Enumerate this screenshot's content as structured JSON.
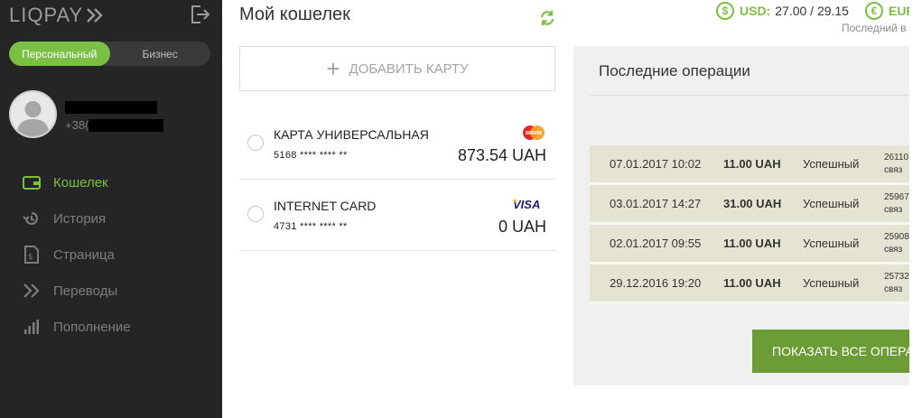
{
  "brand": {
    "name": "LIQPAY"
  },
  "sidebar": {
    "account_types": [
      "Персональный",
      "Бизнес"
    ],
    "active_account_type": "Персональный",
    "profile": {
      "phone_prefix": "+38("
    },
    "nav": [
      {
        "label": "Кошелек",
        "icon": "wallet-icon",
        "active": true
      },
      {
        "label": "История",
        "icon": "history-icon",
        "active": false
      },
      {
        "label": "Страница",
        "icon": "page-icon",
        "active": false
      },
      {
        "label": "Переводы",
        "icon": "transfers-icon",
        "active": false
      },
      {
        "label": "Пополнение",
        "icon": "topup-icon",
        "active": false
      }
    ]
  },
  "wallet": {
    "title": "Мой кошелек",
    "add_card_label": "ДОБАВИТЬ КАРТУ",
    "cards": [
      {
        "name": "КАРТА УНИВЕРСАЛЬНАЯ",
        "number": "5168 **** **** **",
        "balance": "873.54 UAH",
        "brand": "mastercard"
      },
      {
        "name": "INTERNET CARD",
        "number": "4731 **** **** **",
        "balance": "0 UAH",
        "brand": "visa"
      }
    ]
  },
  "rates": {
    "usd_symbol": "$",
    "usd_code": "USD:",
    "usd_value": "27.00 / 29.15",
    "eur_symbol": "€",
    "eur_code": "EUR",
    "note": "Последний в"
  },
  "operations": {
    "title": "Последние операции",
    "rows": [
      {
        "date": "07.01.2017 10:02",
        "amount": "11.00 UAH",
        "status": "Успешный",
        "id": "26110",
        "id_note": "связ"
      },
      {
        "date": "03.01.2017 14:27",
        "amount": "31.00 UAH",
        "status": "Успешный",
        "id": "25967",
        "id_note": "связ"
      },
      {
        "date": "02.01.2017 09:55",
        "amount": "11.00 UAH",
        "status": "Успешный",
        "id": "25908",
        "id_note": "связ"
      },
      {
        "date": "29.12.2016 19:20",
        "amount": "11.00 UAH",
        "status": "Успешный",
        "id": "25732",
        "id_note": "связ"
      }
    ],
    "show_all_label": "ПОКАЗАТЬ ВСЕ ОПЕРА"
  },
  "colors": {
    "accent": "#7ac143",
    "sidebar_bg": "#252525",
    "button_green": "#6c9c35",
    "row_bg": "#e5e4d3"
  }
}
